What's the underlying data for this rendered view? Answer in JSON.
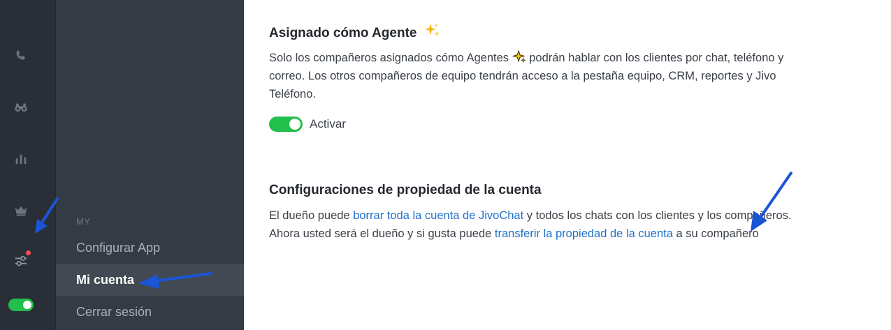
{
  "sidebar_menu": {
    "heading": "MY",
    "items": [
      {
        "label": "Configurar App"
      },
      {
        "label": "Mi cuenta"
      },
      {
        "label": "Cerrar sesión"
      }
    ]
  },
  "agent_section": {
    "title": "Asignado cómo Agente",
    "para_part1": "Solo los compañeros asignados cómo Agentes",
    "para_part2": "podrán hablar con los clientes por chat, teléfono y correo. Los otros compañeros de equipo tendrán acceso a la pestaña equipo, CRM, reportes y Jivo Teléfono.",
    "toggle_label": "Activar"
  },
  "ownership_section": {
    "title": "Configuraciones de propiedad de la cuenta",
    "text_1": "El dueño puede ",
    "link_1": "borrar toda la cuenta de JivoChat",
    "text_2": " y todos los chats con los clientes y los compañeros. Ahora usted será el dueño y si gusta puede ",
    "link_2": "transferir la propiedad de la cuenta",
    "text_3": " a su compañero"
  },
  "colors": {
    "accent_green": "#23bf4c",
    "link_blue": "#1f72c8",
    "notification_red": "#ff4d5a",
    "annotation_arrow": "#1a55d6"
  }
}
